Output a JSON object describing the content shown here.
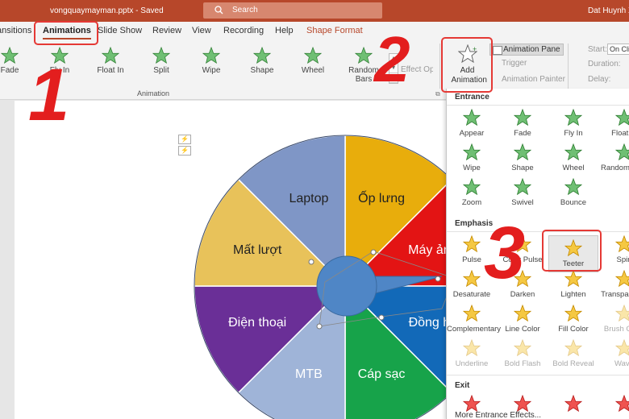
{
  "titlebar": {
    "filename": "vongquaymayman.pptx - Saved",
    "search": "Search",
    "user": "Dat Huynh X"
  },
  "tabs": [
    "Transitions",
    "Animations",
    "Slide Show",
    "Review",
    "View",
    "Recording",
    "Help",
    "Shape Format"
  ],
  "ribbon": {
    "animations": [
      "Fade",
      "Fly In",
      "Float In",
      "Split",
      "Wipe",
      "Shape",
      "Wheel",
      "Random Bars"
    ],
    "group_label": "Animation",
    "effect_options": "Effect Options",
    "add_animation": "Add Animation",
    "animation_pane": "Animation Pane",
    "trigger": "Trigger",
    "animation_painter": "Animation Painter",
    "start_label": "Start:",
    "start_value": "On Click",
    "duration_label": "Duration:",
    "delay_label": "Delay:"
  },
  "slide": {
    "segments": [
      "Laptop",
      "Ốp lưng",
      "Mất lượt",
      "Máy ảnh",
      "Điện thoại",
      "Đồng hồ",
      "MTB",
      "Cáp sạc"
    ]
  },
  "panel": {
    "entrance_title": "Entrance",
    "entrance": [
      "Appear",
      "Fade",
      "Fly In",
      "Float In",
      "Wipe",
      "Shape",
      "Wheel",
      "Random Bars",
      "Zoom",
      "Swivel",
      "Bounce"
    ],
    "emphasis_title": "Emphasis",
    "emphasis": [
      "Pulse",
      "Color Pulse",
      "Teeter",
      "Spin",
      "Desaturate",
      "Darken",
      "Lighten",
      "Transparency",
      "Complementary",
      "Line Color",
      "Fill Color",
      "Brush Color",
      "Underline",
      "Bold Flash",
      "Bold Reveal",
      "Wave"
    ],
    "exit_title": "Exit",
    "more_entrance": "More Entrance Effects..."
  },
  "overlay": {
    "step1": "1",
    "step2": "2",
    "step3": "3"
  },
  "colors": {
    "accent": "#b7472a",
    "entrance_star": "#4caf50",
    "emphasis_star": "#f5b400",
    "exit_star": "#e53935",
    "wheel": {
      "laptop": "#7f96c6",
      "op_lung": "#e8ad0c",
      "mat_luot": "#e8c25a",
      "may_anh": "#e31414",
      "dien_thoai": "#6a2f97",
      "dong_ho": "#1269b8",
      "mtb": "#9fb4d8",
      "cap_sac": "#17a34a",
      "pointer": "#4f86c6"
    },
    "annotation": "#e31e1e"
  }
}
